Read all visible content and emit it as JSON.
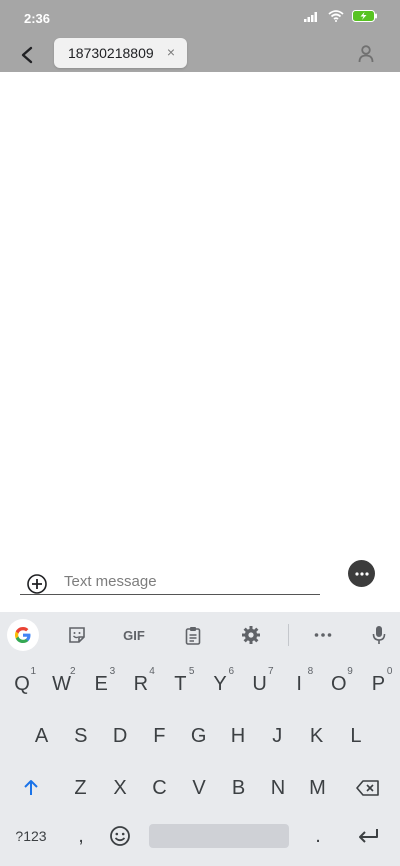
{
  "status_bar": {
    "time": "2:36"
  },
  "header": {
    "recipient": "18730218809",
    "remove_symbol": "×"
  },
  "compose": {
    "placeholder": "Text message"
  },
  "keyboard": {
    "toolbar": {
      "gif_label": "GIF"
    },
    "row1": [
      {
        "key": "Q",
        "hint": "1"
      },
      {
        "key": "W",
        "hint": "2"
      },
      {
        "key": "E",
        "hint": "3"
      },
      {
        "key": "R",
        "hint": "4"
      },
      {
        "key": "T",
        "hint": "5"
      },
      {
        "key": "Y",
        "hint": "6"
      },
      {
        "key": "U",
        "hint": "7"
      },
      {
        "key": "I",
        "hint": "8"
      },
      {
        "key": "O",
        "hint": "9"
      },
      {
        "key": "P",
        "hint": "0"
      }
    ],
    "row2": [
      "A",
      "S",
      "D",
      "F",
      "G",
      "H",
      "J",
      "K",
      "L"
    ],
    "row3": [
      "Z",
      "X",
      "C",
      "V",
      "B",
      "N",
      "M"
    ],
    "bottom": {
      "symbols_label": "?123",
      "comma": ",",
      "period": "."
    }
  },
  "colors": {
    "bar_gray": "#a6a6a6",
    "shift_blue": "#1a73e8",
    "battery_green": "#58c322"
  }
}
